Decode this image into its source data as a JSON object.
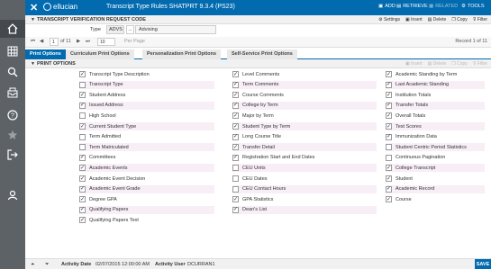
{
  "rail": [
    "home-icon",
    "grid-icon",
    "search-icon",
    "inbox-icon",
    "help-icon",
    "star-icon",
    "signout-icon",
    "user-icon"
  ],
  "topbar": {
    "close": "✕",
    "brand": "ellucian",
    "title": "Transcript Type Rules SHATPRT 9.3.4 (PS23)",
    "add": "ADD",
    "retrieve": "RETRIEVE",
    "related": "RELATED",
    "tools": "TOOLS"
  },
  "key_block": {
    "header": "TRANSCRIPT VERIFICATION REQUEST CODE",
    "tools": {
      "settings": "Settings",
      "insert": "Insert",
      "delete": "Delete",
      "copy": "Copy",
      "filter": "Filter"
    },
    "type_label": "Type",
    "type_value": "ADVS",
    "lookup": "...",
    "type_desc": "Advising"
  },
  "pager": {
    "page_label": "of 11",
    "page_value": "1",
    "per_page_value": "10",
    "per_page_label": "Per Page",
    "record": "Record 1 of 11"
  },
  "tabs": [
    "Print Options",
    "Curriculum Print Options",
    "Personalization Print Options",
    "Self-Service Print Options"
  ],
  "print_options": {
    "header": "PRINT OPTIONS",
    "tools": {
      "insert": "Insert",
      "delete": "Delete",
      "copy": "Copy",
      "filter": "Filter"
    },
    "columns": [
      [
        {
          "label": "Transcript Type Description",
          "checked": true
        },
        {
          "label": "Transcript Type",
          "checked": false
        },
        {
          "label": "Student Address",
          "checked": true
        },
        {
          "label": "Issued Address",
          "checked": true
        },
        {
          "label": "High School",
          "checked": false
        },
        {
          "label": "Current Student Type",
          "checked": true
        },
        {
          "label": "Term Admitted",
          "checked": false
        },
        {
          "label": "Term Matriculated",
          "checked": false
        },
        {
          "label": "Committees",
          "checked": true
        },
        {
          "label": "Academic Events",
          "checked": true
        },
        {
          "label": "Academic Event Decision",
          "checked": true
        },
        {
          "label": "Academic Event Grade",
          "checked": true
        },
        {
          "label": "Degree GPA",
          "checked": true
        },
        {
          "label": "Qualifying Papers",
          "checked": true
        },
        {
          "label": "Qualifying Papers Text",
          "checked": true
        }
      ],
      [
        {
          "label": "Level Comments",
          "checked": true
        },
        {
          "label": "Term Comments",
          "checked": true
        },
        {
          "label": "Course Comments",
          "checked": true
        },
        {
          "label": "College by Term",
          "checked": true
        },
        {
          "label": "Major by Term",
          "checked": true
        },
        {
          "label": "Student Type by Term",
          "checked": true
        },
        {
          "label": "Long Course Title",
          "checked": true
        },
        {
          "label": "Transfer Detail",
          "checked": true
        },
        {
          "label": "Registration Start and End Dates",
          "checked": true
        },
        {
          "label": "CEU Units",
          "checked": false
        },
        {
          "label": "CEU Dates",
          "checked": false
        },
        {
          "label": "CEU Contact Hours",
          "checked": false
        },
        {
          "label": "GPA Statistics",
          "checked": true
        },
        {
          "label": "Dean's List",
          "checked": true
        }
      ],
      [
        {
          "label": "Academic Standing by Term",
          "checked": true
        },
        {
          "label": "Last Academic Standing",
          "checked": true
        },
        {
          "label": "Institution Totals",
          "checked": true
        },
        {
          "label": "Transfer Totals",
          "checked": true
        },
        {
          "label": "Overall Totals",
          "checked": true
        },
        {
          "label": "Test Scores",
          "checked": true
        },
        {
          "label": "Immunization Data",
          "checked": true
        },
        {
          "label": "Student Centric Period Statistics",
          "checked": false
        },
        {
          "label": "Continuous Pagination",
          "checked": false
        },
        {
          "label": "College Transcript",
          "checked": true
        },
        {
          "label": "Student",
          "checked": true
        },
        {
          "label": "Academic Record",
          "checked": true
        },
        {
          "label": "Course",
          "checked": true
        }
      ]
    ]
  },
  "footer": {
    "activity_date_label": "Activity Date",
    "activity_date": "02/07/2015 12:00:00 AM",
    "activity_user_label": "Activity User",
    "activity_user": "DCURRAN1",
    "save": "SAVE"
  },
  "colors": {
    "brand_blue": "#026bb0",
    "rail": "#5c6266",
    "stripe": "#f7eef6"
  }
}
